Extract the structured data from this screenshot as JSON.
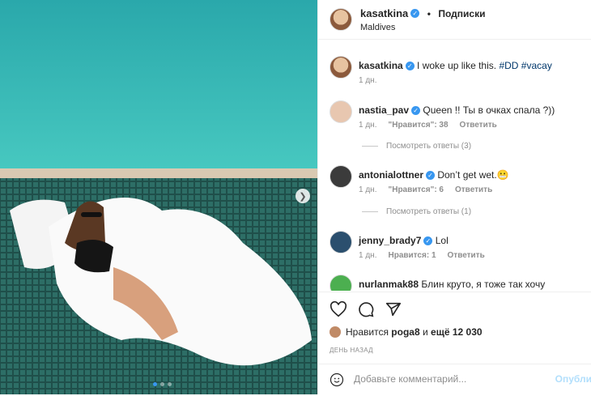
{
  "post_author": {
    "username": "kasatkina",
    "location": "Maldives",
    "follow_label": "Подписки"
  },
  "caption": {
    "username": "kasatkina",
    "text": "I woke up like this.",
    "tags": [
      "#DD",
      "#vacay"
    ],
    "time": "1 дн."
  },
  "comments": [
    {
      "username": "nastia_pav",
      "verified": true,
      "text": "Queen !! Ты в очках спала ?))",
      "time": "1 дн.",
      "likes": "\"Нравится\": 38",
      "reply": "Ответить",
      "replies": "Посмотреть ответы (3)"
    },
    {
      "username": "antonialottner",
      "verified": true,
      "text": "Don’t get wet.😬",
      "time": "1 дн.",
      "likes": "\"Нравится\": 6",
      "reply": "Ответить",
      "replies": "Посмотреть ответы (1)"
    },
    {
      "username": "jenny_brady7",
      "verified": true,
      "text": "Lol",
      "time": "1 дн.",
      "likes": "Нравится: 1",
      "reply": "Ответить"
    },
    {
      "username": "nurlanmak88",
      "verified": false,
      "text": "Блин круто, я тоже так хочу"
    }
  ],
  "likes_line": {
    "prefix": "Нравится",
    "user": "poga8",
    "middle": "и",
    "rest": "ещё 12 030"
  },
  "posted": "ДЕНЬ НАЗАД",
  "comment_box": {
    "placeholder": "Добавьте комментарий...",
    "publish": "Опубли"
  },
  "colors": {
    "accent": "#3897f0",
    "water": "#2fb6b4"
  }
}
